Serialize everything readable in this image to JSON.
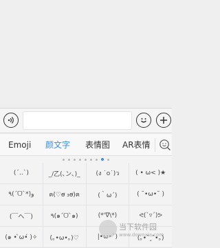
{
  "input_bar": {
    "voice_icon": "voice-icon",
    "emoji_icon": "smiley-icon",
    "plus_icon": "plus-icon",
    "text_value": ""
  },
  "tabs": [
    {
      "label": "Emoji",
      "active": false
    },
    {
      "label": "颜文字",
      "active": true
    },
    {
      "label": "表情图",
      "active": false
    },
    {
      "label": "AR表情",
      "active": false
    }
  ],
  "search_icon": "search-emoji-icon",
  "pagination": {
    "total": 9,
    "active_index": 7
  },
  "kaomoji_grid": [
    [
      "(´‥`)",
      "_/乙(､ン､)_",
      "(ง ˙o˙)ว",
      "( • ω< )★"
    ],
    [
      "٩(ˊᗜˋ*)و",
      "ฅ(♡ơ̴ ₃ơ̴)ฅ",
      "(｀ω´)",
      "( ˘•ω•˘ )"
    ],
    [
      "(￣へ￣)",
      "٩(๑ˊᗜˋ๑)",
      "(*'∇\\*)",
      "ᕙ(`▿´)ᕗ"
    ],
    [
      "(๑ • ̀ω•́ )✧",
      "(｡•ω•｡)♡",
      "|•ω•`)",
      "(｡•ˇ‸ˇ•｡)"
    ]
  ],
  "watermark": {
    "title": "当下软件园",
    "url": "www.downxia.com"
  },
  "colors": {
    "accent": "#3a8ee6",
    "background": "#efefef",
    "panel": "#f3f3f4"
  }
}
